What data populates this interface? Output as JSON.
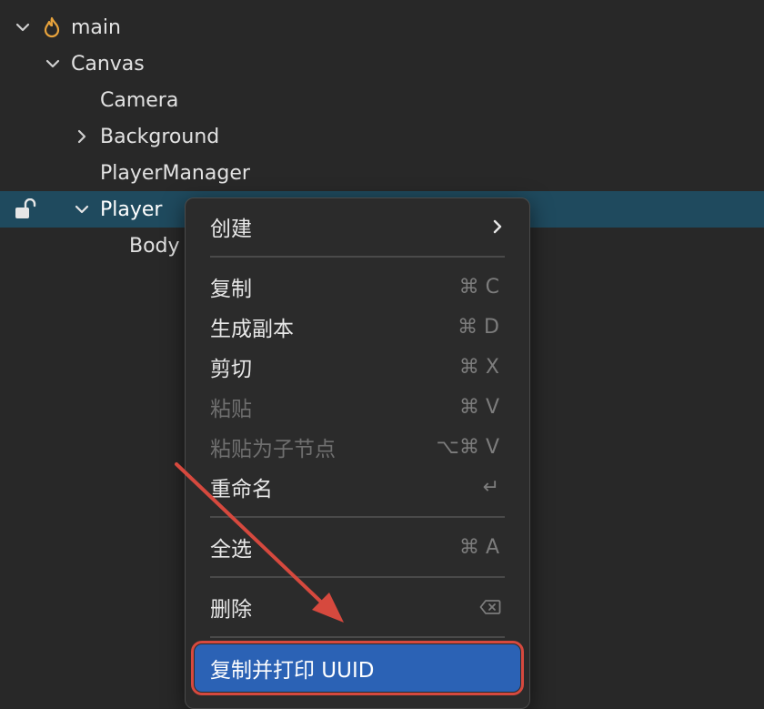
{
  "hierarchy": {
    "items": [
      {
        "label": "main"
      },
      {
        "label": "Canvas"
      },
      {
        "label": "Camera"
      },
      {
        "label": "Background"
      },
      {
        "label": "PlayerManager"
      },
      {
        "label": "Player"
      },
      {
        "label": "Body"
      }
    ]
  },
  "context_menu": {
    "create": {
      "label": "创建"
    },
    "copy": {
      "label": "复制",
      "shortcut": "⌘ C"
    },
    "duplicate": {
      "label": "生成副本",
      "shortcut": "⌘ D"
    },
    "cut": {
      "label": "剪切",
      "shortcut": "⌘ X"
    },
    "paste": {
      "label": "粘贴",
      "shortcut": "⌘ V"
    },
    "paste_child": {
      "label": "粘贴为子节点",
      "shortcut": "⌥⌘ V"
    },
    "rename": {
      "label": "重命名",
      "shortcut": "↵"
    },
    "select_all": {
      "label": "全选",
      "shortcut": "⌘ A"
    },
    "delete": {
      "label": "删除"
    },
    "copy_print_uuid": {
      "label": "复制并打印 UUID"
    }
  },
  "colors": {
    "selected_row": "#1f4a5e",
    "highlight": "#2b62b5",
    "annotation": "#d6493e"
  }
}
